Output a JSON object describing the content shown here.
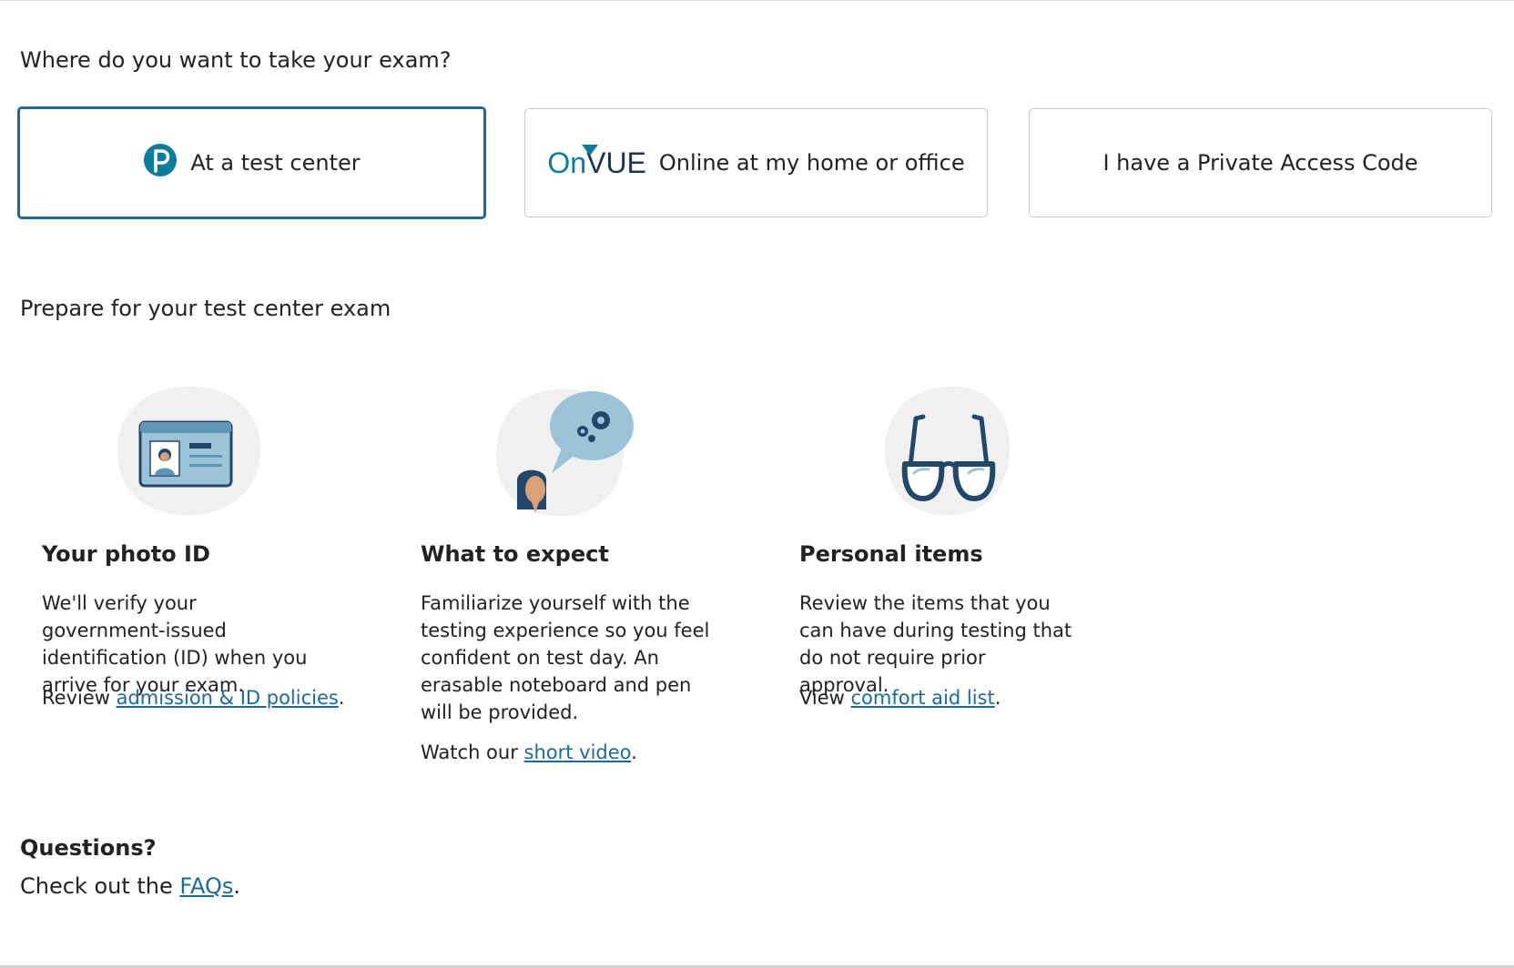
{
  "exam_location": {
    "heading": "Where do you want to take your exam?",
    "options": [
      {
        "label": "At a test center",
        "icon": "pearson-logo-icon",
        "selected": true
      },
      {
        "label": "Online at my home or office",
        "icon": "onvue-logo-icon",
        "logo_text_on": "On",
        "logo_text_vue": "VUE",
        "selected": false
      },
      {
        "label": "I have a Private Access Code",
        "selected": false
      }
    ]
  },
  "prepare": {
    "heading": "Prepare for your test center exam",
    "cards": [
      {
        "title": "Your photo ID",
        "description": "We'll verify your government-issued identification (ID) when you arrive for your exam.",
        "cta_prefix": "Review ",
        "link_text": "admission & ID policies",
        "cta_suffix": ".",
        "icon": "id-card-icon"
      },
      {
        "title": "What to expect",
        "description": "Familiarize yourself with the testing experience so you feel confident on test day. An erasable noteboard and pen will be provided.",
        "cta_prefix": "Watch our ",
        "link_text": "short video",
        "cta_suffix": ".",
        "icon": "thinking-person-icon"
      },
      {
        "title": "Personal items",
        "description": "Review the items that you can have during testing that do not require prior approval.",
        "cta_prefix": "View ",
        "link_text": "comfort aid list",
        "cta_suffix": ".",
        "icon": "eyeglasses-icon"
      }
    ]
  },
  "questions": {
    "title": "Questions?",
    "text_prefix": "Check out the ",
    "link_text": "FAQs",
    "text_suffix": "."
  },
  "colors": {
    "accent": "#1b6a99",
    "pearson_teal": "#0d7b9b",
    "onvue_teal": "#0d7b9b",
    "onvue_navy": "#1c3557",
    "illustration_blob": "#f0f0f0",
    "illustration_blue": "#9cc3d8",
    "illustration_navy": "#23466b"
  }
}
